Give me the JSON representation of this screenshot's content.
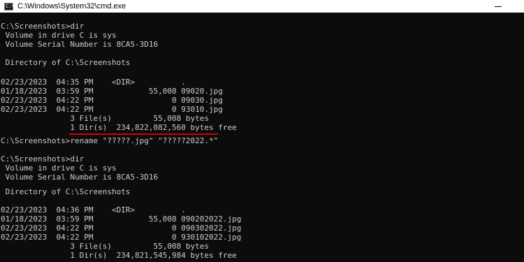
{
  "window": {
    "title": "C:\\Windows\\System32\\cmd.exe",
    "icon": "cmd-icon"
  },
  "console": {
    "lines": [
      "C:\\Screenshots>dir",
      " Volume in drive C is sys",
      " Volume Serial Number is 8CA5-3D16",
      "",
      " Directory of C:\\Screenshots",
      "",
      "02/23/2023  04:35 PM    <DIR>          .",
      "01/18/2023  03:59 PM            55,008 09020.jpg",
      "02/23/2023  04:22 PM                 0 09030.jpg",
      "02/23/2023  04:22 PM                 0 93010.jpg",
      "               3 File(s)         55,008 bytes",
      "               1 Dir(s)  234,822,082,560 bytes free",
      "",
      "C:\\Screenshots>rename \"?????.jpg\" \"?????2022.*\"",
      "",
      "C:\\Screenshots>dir",
      " Volume in drive C is sys",
      " Volume Serial Number is 8CA5-3D16",
      "",
      " Directory of C:\\Screenshots",
      "",
      "02/23/2023  04:36 PM    <DIR>          .",
      "01/18/2023  03:59 PM            55,008 090202022.jpg",
      "02/23/2023  04:22 PM                 0 090302022.jpg",
      "02/23/2023  04:22 PM                 0 930102022.jpg",
      "               3 File(s)         55,008 bytes",
      "               1 Dir(s)  234,821,545,984 bytes free"
    ]
  },
  "colors": {
    "background": "#0c0c0c",
    "text": "#cccccc",
    "highlight_underline": "#d40000"
  }
}
